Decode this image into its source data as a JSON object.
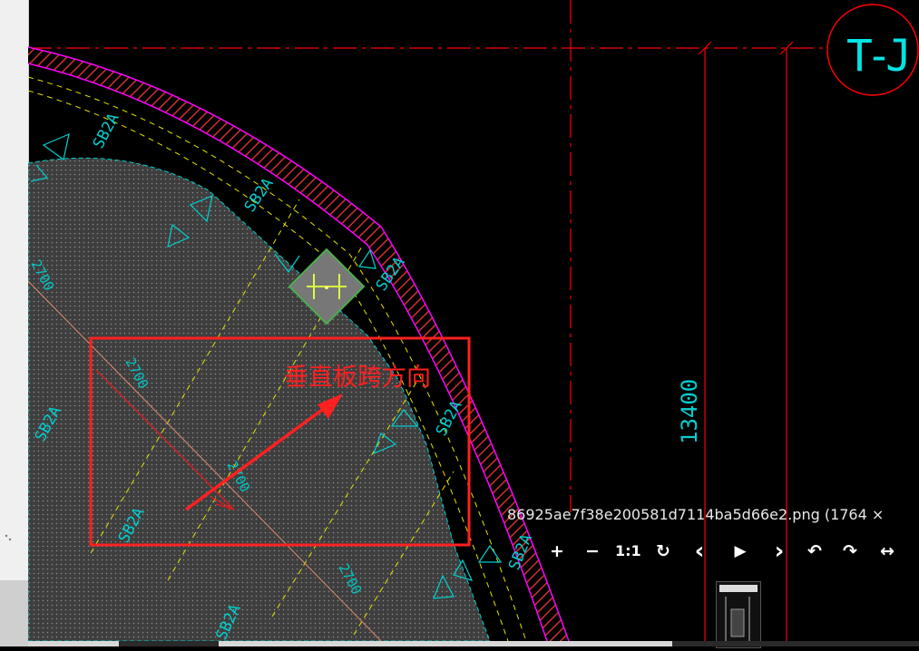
{
  "viewer": {
    "filename": "86925ae7f38e200581d7114ba5d66e2.png (1764 ×",
    "toolbar": [
      {
        "name": "zoom-in-button",
        "icon": "plus-icon",
        "glyph": "+"
      },
      {
        "name": "zoom-out-button",
        "icon": "minus-icon",
        "glyph": "−"
      },
      {
        "name": "actual-size-button",
        "icon": "one-to-one-icon",
        "glyph": "1:1"
      },
      {
        "name": "rotate-button",
        "icon": "rotate-icon",
        "glyph": "↻"
      },
      {
        "name": "previous-button",
        "icon": "chevron-left-icon",
        "glyph": "‹"
      },
      {
        "name": "slideshow-button",
        "icon": "play-icon",
        "glyph": "▶"
      },
      {
        "name": "next-button",
        "icon": "chevron-right-icon",
        "glyph": "›"
      },
      {
        "name": "undo-button",
        "icon": "undo-icon",
        "glyph": "↶"
      },
      {
        "name": "redo-button",
        "icon": "redo-icon",
        "glyph": "↷"
      },
      {
        "name": "flip-button",
        "icon": "flip-horizontal-icon",
        "glyph": "↔"
      }
    ]
  },
  "drawing": {
    "grid_label": "T-J",
    "dimension_label": "13400",
    "annotation": "垂直板跨方向",
    "slab_labels": [
      "SB2A",
      "SB2A",
      "SB2A",
      "SB2A",
      "SB2A",
      "SB2A",
      "SB2A",
      "SB2A"
    ],
    "span_labels": [
      "2700",
      "2700",
      "2700",
      "2700"
    ],
    "colors": {
      "background": "#000000",
      "axis_red": "#ff0000",
      "wall_magenta": "#ff00ff",
      "slab_cyan": "#00e5e5",
      "dash_yellow": "#e5e500",
      "annotation_red": "#ff2020",
      "marker_green": "#4caf50"
    }
  }
}
